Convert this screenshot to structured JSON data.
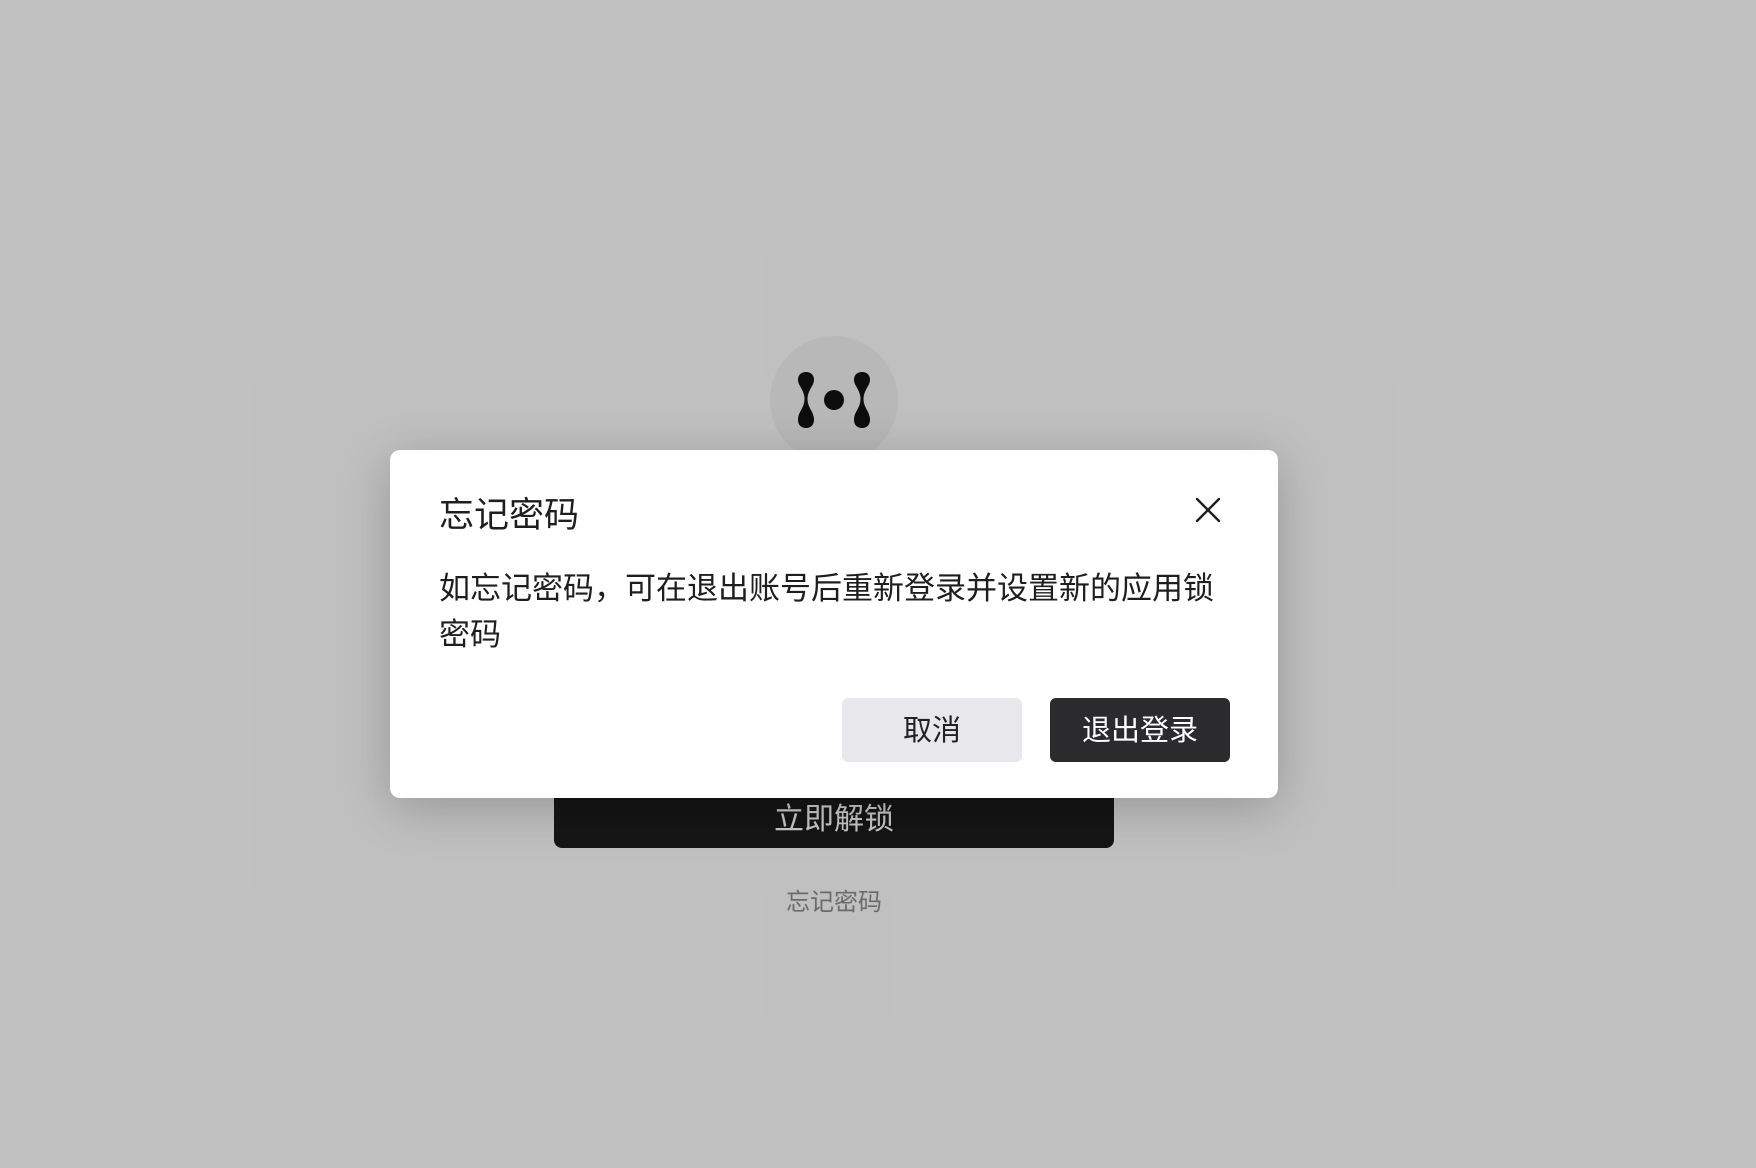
{
  "lock_screen": {
    "logo_icon": "app-logo-icon",
    "unlock_label": "立即解锁",
    "forgot_password_link": "忘记密码"
  },
  "dialog": {
    "title": "忘记密码",
    "message": "如忘记密码，可在退出账号后重新登录并设置新的应用锁密码",
    "close_icon": "close-icon",
    "cancel_label": "取消",
    "logout_label": "退出登录"
  },
  "colors": {
    "background": "#f7f7f7",
    "overlay": "#c6c6c6",
    "primary_button": "#1c1c1c",
    "dialog_primary_button": "#2b2b2d",
    "secondary_button": "#e8e8ec",
    "link_text": "#8a8a8a"
  }
}
